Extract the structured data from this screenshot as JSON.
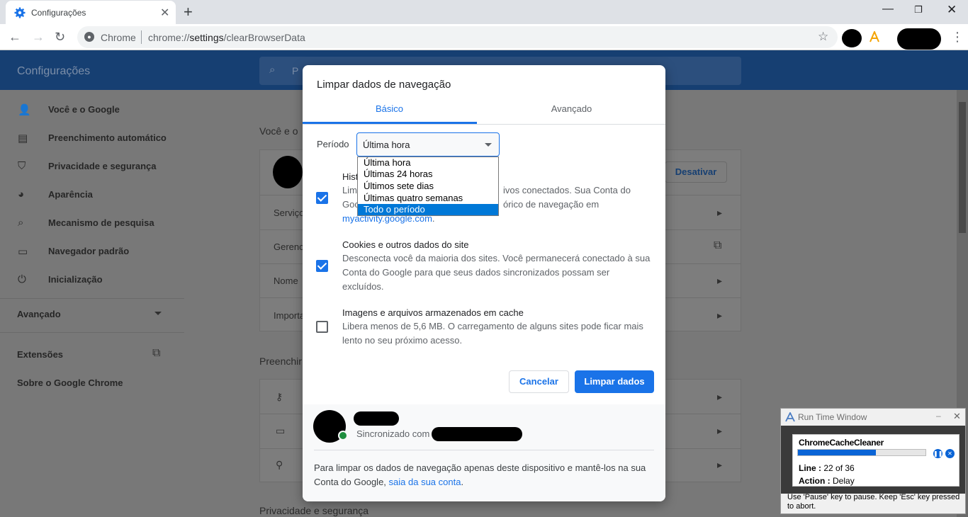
{
  "browser": {
    "tab_title": "Configurações",
    "new_tab": "+",
    "omnibox_label": "Chrome",
    "url_scheme": "chrome://",
    "url_path": "settings",
    "url_rest": "/clearBrowserData"
  },
  "settings": {
    "header_title": "Configurações",
    "search_placeholder": "P",
    "sidebar": [
      {
        "label": "Você e o Google",
        "icon": "person-icon"
      },
      {
        "label": "Preenchimento automático",
        "icon": "clipboard-icon"
      },
      {
        "label": "Privacidade e segurança",
        "icon": "shield-icon"
      },
      {
        "label": "Aparência",
        "icon": "palette-icon"
      },
      {
        "label": "Mecanismo de pesquisa",
        "icon": "search-icon"
      },
      {
        "label": "Navegador padrão",
        "icon": "browser-icon"
      },
      {
        "label": "Inicialização",
        "icon": "power-icon"
      }
    ],
    "advanced": "Avançado",
    "extensions": "Extensões",
    "about": "Sobre o Google Chrome",
    "section_you": "Você e o",
    "disable_button": "Desativar",
    "rows": [
      "Serviço",
      "Gerenc",
      "Nome",
      "Importa"
    ],
    "section_autofill": "Preenchir",
    "section_privacy": "Privacidade e segurança"
  },
  "dialog": {
    "title": "Limpar dados de navegação",
    "tab_basic": "Básico",
    "tab_advanced": "Avançado",
    "period_label": "Período",
    "period_value": "Última hora",
    "period_options": [
      "Última hora",
      "Últimas 24 horas",
      "Últimos sete dias",
      "Últimas quatro semanas",
      "Todo o período"
    ],
    "history_title": "Hist",
    "history_desc1a": "Lim",
    "history_desc1b": "ivos conectados. Sua Conta do",
    "history_desc2a": "Goo",
    "history_desc2b": "órico de navegação em",
    "history_link": "myactivity.google.com",
    "history_dot": ".",
    "cookies_title": "Cookies e outros dados do site",
    "cookies_desc": [
      "Desconecta você da maioria dos sites. Você permanecerá conectado à sua",
      "Conta do Google para que seus dados sincronizados possam ser",
      "excluídos."
    ],
    "cache_title": "Imagens e arquivos armazenados em cache",
    "cache_desc": [
      "Libera menos de 5,6 MB. O carregamento de alguns sites pode ficar mais",
      "lento no seu próximo acesso."
    ],
    "cancel": "Cancelar",
    "clear": "Limpar dados",
    "synced_with": "Sincronizado com",
    "footer_text1": "Para limpar os dados de navegação apenas deste dispositivo e mantê-los na sua",
    "footer_text2": "Conta do Google,",
    "footer_link": "saia da sua conta",
    "footer_dot": "."
  },
  "runtime": {
    "title": "Run Time Window",
    "script": "ChromeCacheCleaner",
    "progress": 0.61,
    "line_label": "Line :",
    "line_value": "22 of 36",
    "action_label": "Action :",
    "action_value": "Delay",
    "hint": "Use 'Pause' key to pause. Keep 'Esc' key pressed to abort."
  }
}
